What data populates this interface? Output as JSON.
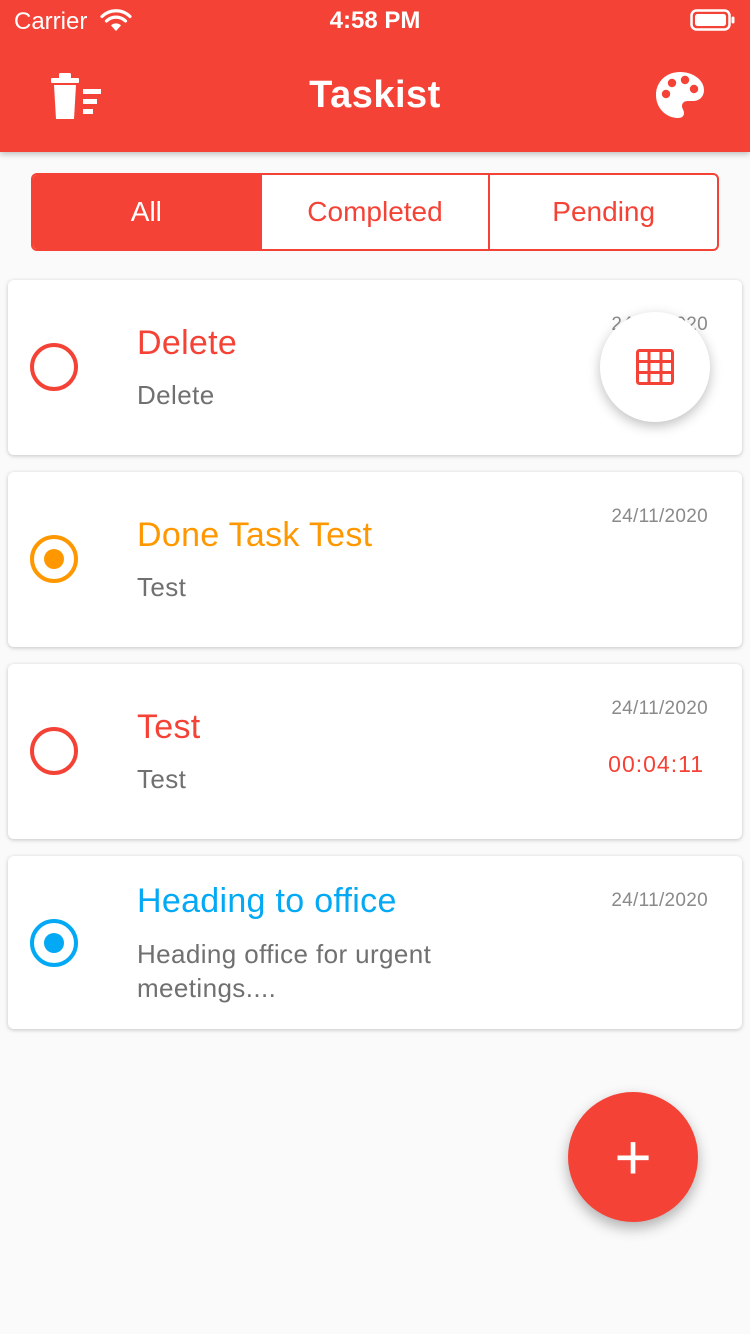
{
  "status_bar": {
    "carrier": "Carrier",
    "time": "4:58 PM"
  },
  "app_bar": {
    "title": "Taskist",
    "left_icon": "delete-all-icon",
    "right_icon": "palette-icon"
  },
  "filters": {
    "all": "All",
    "completed": "Completed",
    "pending": "Pending",
    "selected": "All"
  },
  "tasks": [
    {
      "title": "Delete",
      "description": "Delete",
      "date": "24/11/2020",
      "status": "pending",
      "color": "#f44336"
    },
    {
      "title": "Done Task Test",
      "description": "Test",
      "date": "24/11/2020",
      "status": "completed",
      "color": "#ff9800"
    },
    {
      "title": "Test",
      "description": "Test",
      "date": "24/11/2020",
      "timer": "00:04:11",
      "status": "pending",
      "color": "#f44336"
    },
    {
      "title": "Heading to office",
      "description": "Heading office for urgent meetings....",
      "date": "24/11/2020",
      "status": "completed",
      "color": "#03a9f4"
    }
  ],
  "colors": {
    "primary": "#f44336",
    "completed_orange": "#ff9800",
    "completed_blue": "#03a9f4"
  },
  "fab": {
    "add_symbol": "+",
    "calendar_icon": "calendar-grid-icon"
  }
}
